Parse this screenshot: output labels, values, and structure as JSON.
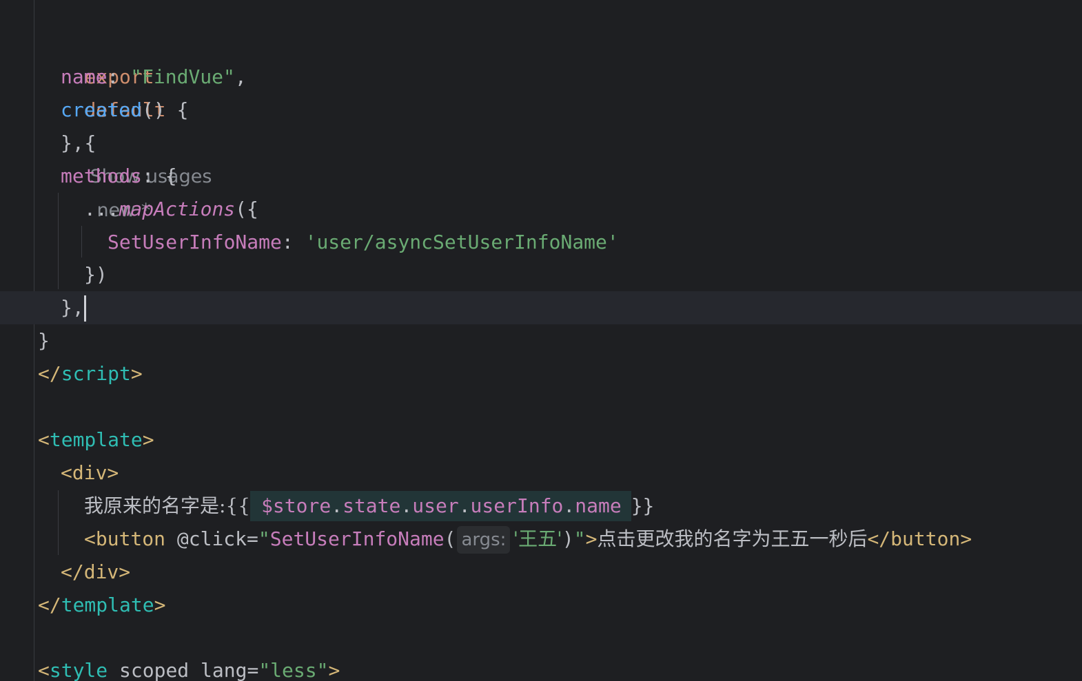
{
  "editor": {
    "hints": {
      "show_usages": "Show usages",
      "new_label": "new *"
    },
    "code": {
      "l1_kw1": "export",
      "l1_kw2": "default",
      "l1_brace": "{",
      "l2_key": "name",
      "l2_colon": ": ",
      "l2_value": "\"FindVue\"",
      "l2_comma": ",",
      "l3_fn": "created",
      "l3_rest": "() {",
      "l4_text": "},",
      "l5_key": "methods",
      "l5_rest": ": {",
      "l6_spread": "...",
      "l6_fn": "mapActions",
      "l6_rest": "({",
      "l7_key": "SetUserInfoName",
      "l7_colon": ": ",
      "l7_value": "'user/asyncSetUserInfoName'",
      "l8_text": "})",
      "l9_text": "},",
      "l10_text": "}",
      "l11_open": "</",
      "l11_name": "script",
      "l11_close": ">",
      "l13_open": "<",
      "l13_name": "template",
      "l13_close": ">",
      "l14_tag": "<div>",
      "l15_text": "我原来的名字是:{{",
      "l15_expr_store": "$store",
      "l15_expr_rest_dot1": ".",
      "l15_expr_state": "state",
      "l15_expr_dot2": ".",
      "l15_expr_user": "user",
      "l15_expr_dot3": ".",
      "l15_expr_userinfo": "userInfo",
      "l15_expr_dot4": ".",
      "l15_expr_name": "name",
      "l15_end": "}}",
      "l16_open": "<button",
      "l16_attr": " @click=",
      "l16_q1": "\"",
      "l16_fn": "SetUserInfoName",
      "l16_paren": "(",
      "l16_inlay": "args:",
      "l16_arg": "'王五'",
      "l16_close_paren": ")",
      "l16_q2": "\"",
      "l16_gt": ">",
      "l16_text": "点击更改我的名字为王五一秒后",
      "l16_end_tag": "</button>",
      "l17_tag": "</div>",
      "l18_open": "</",
      "l18_name": "template",
      "l18_close": ">",
      "l20_open": "<",
      "l20_name": "style",
      "l20_attr1": " scoped lang=",
      "l20_value": "\"less\"",
      "l20_close": ">"
    }
  }
}
